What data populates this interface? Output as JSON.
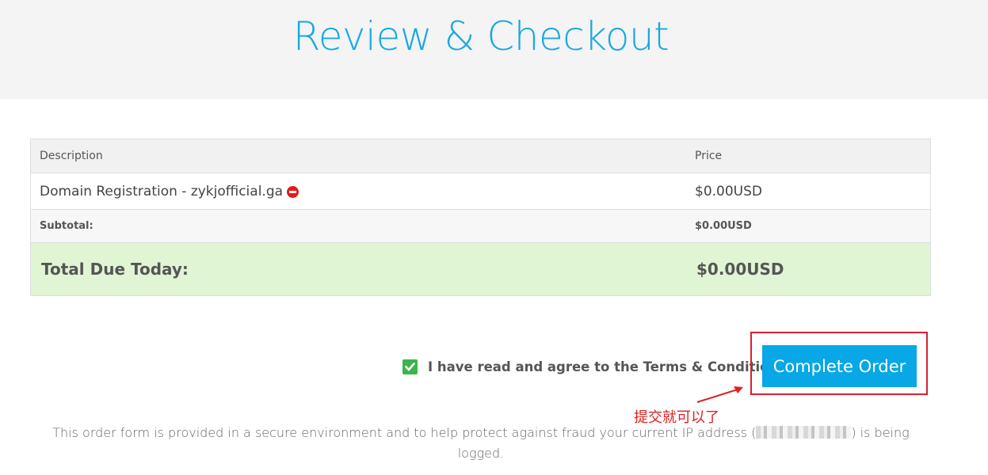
{
  "header": {
    "title": "Review & Checkout"
  },
  "order_table": {
    "columns": [
      "Description",
      "Price"
    ],
    "items": [
      {
        "description": "Domain Registration - zykjofficial.ga",
        "price": "$0.00USD",
        "remove_icon": "remove-circle-icon"
      }
    ],
    "subtotal_label": "Subtotal:",
    "subtotal_value": "$0.00USD",
    "total_label": "Total Due Today:",
    "total_value": "$0.00USD"
  },
  "agreement": {
    "checked": true,
    "text": "I have read and agree to the ",
    "link_text": "Terms & Conditions"
  },
  "complete_button": {
    "label": "Complete Order"
  },
  "annotation": {
    "text": "提交就可以了",
    "color": "#e0201f"
  },
  "footer": {
    "secure_text_before": "This order form is provided in a secure environment and to help protect against fraud your current IP address (",
    "secure_text_after": ") is being logged."
  },
  "colors": {
    "accent": "#17a9e1",
    "button": "#08a7e6",
    "total_row": "#dff5d4",
    "checkbox": "#3bb54a",
    "highlight": "#d7202f"
  }
}
